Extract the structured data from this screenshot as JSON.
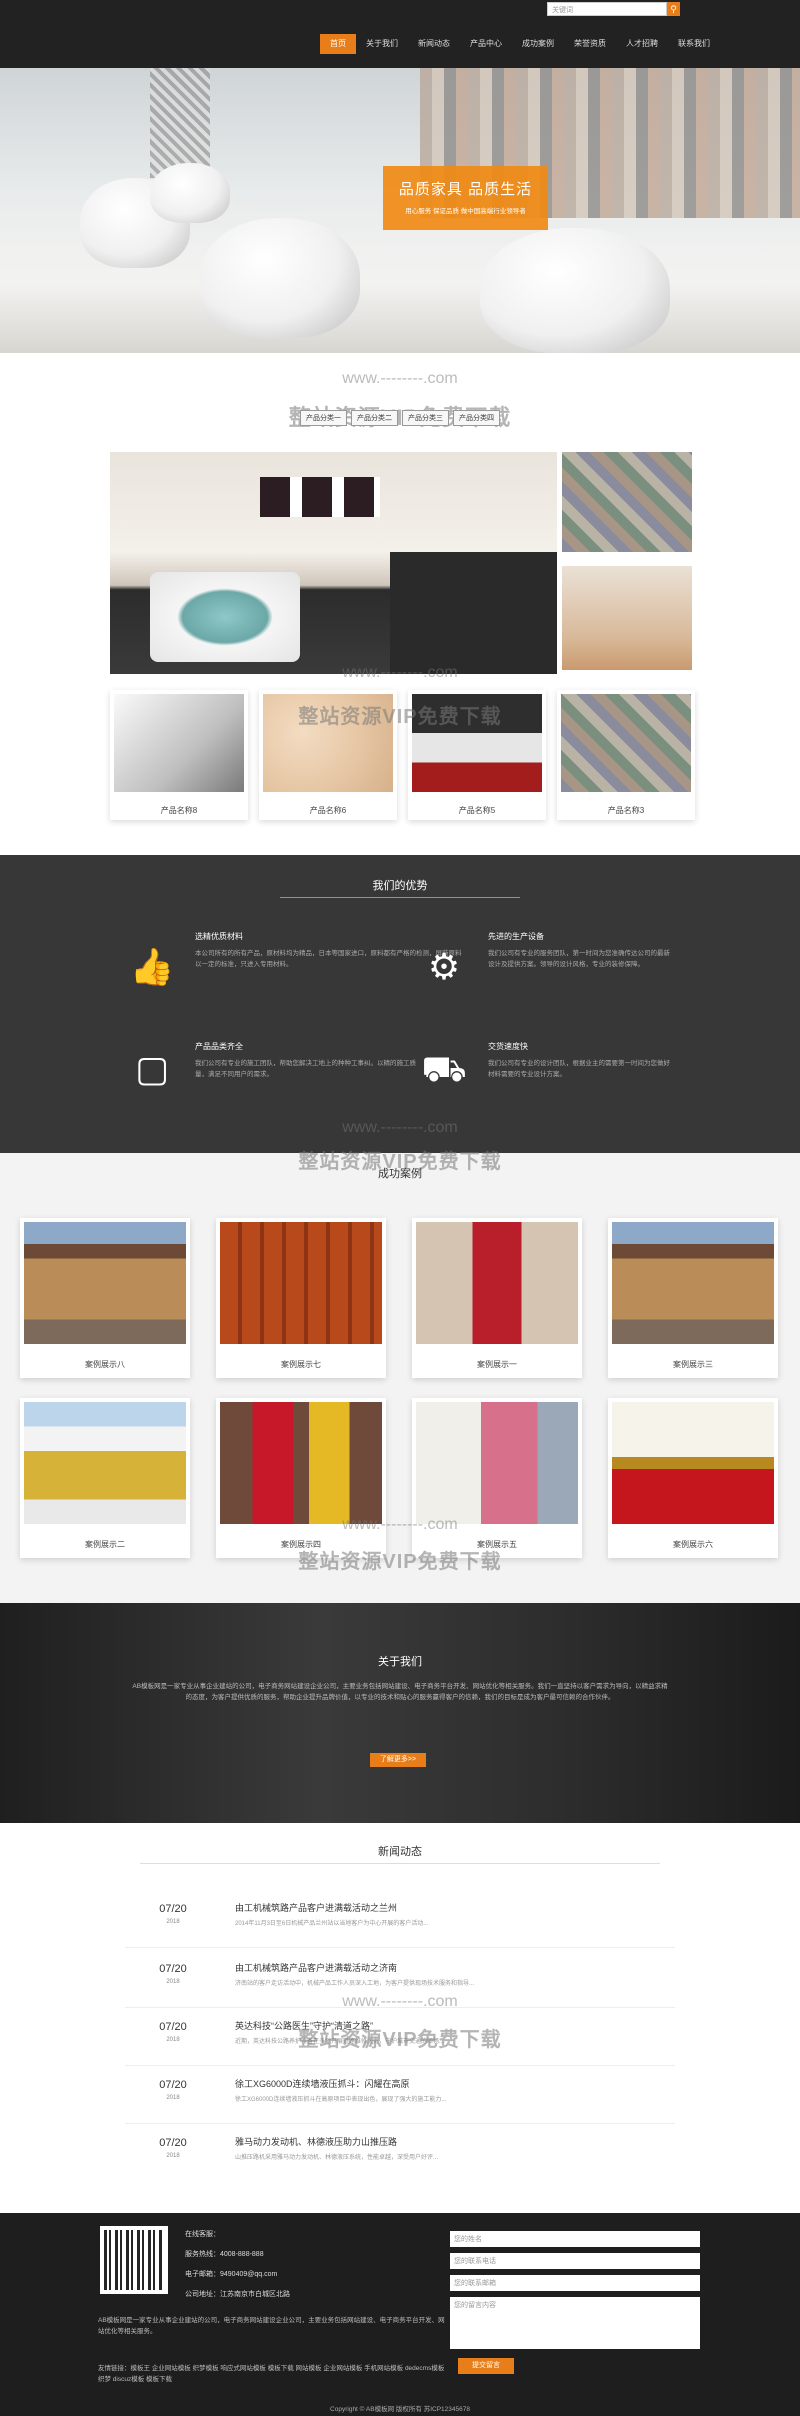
{
  "header": {
    "search_placeholder": "关键词",
    "search_icon": "search-icon",
    "nav": [
      {
        "label": "首页",
        "active": true
      },
      {
        "label": "关于我们",
        "active": false
      },
      {
        "label": "新闻动态",
        "active": false
      },
      {
        "label": "产品中心",
        "active": false
      },
      {
        "label": "成功案例",
        "active": false
      },
      {
        "label": "荣誉资质",
        "active": false
      },
      {
        "label": "人才招聘",
        "active": false
      },
      {
        "label": "联系我们",
        "active": false
      }
    ]
  },
  "hero": {
    "title": "品质家具 品质生活",
    "subtitle": "用心服务 保证品质 做中国高端行业领导者"
  },
  "watermark": {
    "url": "www.--------.com",
    "text": "整站资源VIP免费下载"
  },
  "products": {
    "tabs": [
      "产品分类一",
      "产品分类二",
      "产品分类三",
      "产品分类四"
    ],
    "items": [
      "产品名称8",
      "产品名称6",
      "产品名称5",
      "产品名称3"
    ]
  },
  "advantages": {
    "title": "我们的优势",
    "items": [
      {
        "title": "选精优质材料",
        "text": "本公司所有的所有产品，原材料均为精品，日本等国家进口，原料都有严格的检测，屏蔽原料以一定的标准，只进入专用材料。",
        "icon": "thumbs-up-icon"
      },
      {
        "title": "先进的生产设备",
        "text": "我们公司有专业的服务团队，第一时间为您准确传达公司的最新设计及提供方案。领导的设计风格，专业的装修保障。",
        "icon": "gear-icon"
      },
      {
        "title": "产品品类齐全",
        "text": "我们公司有专业的施工团队，帮助您解决工地上的种种工事纠。以精的施工质量，满足不同用户的需求。",
        "icon": "boxes-icon"
      },
      {
        "title": "交货速度快",
        "text": "我们公司有专业的设计团队，根据业主的需要第一时间为您做好材料需要的专业设计方案。",
        "icon": "truck-icon"
      }
    ]
  },
  "cases": {
    "title": "成功案例",
    "items": [
      "案例展示八",
      "案例展示七",
      "案例展示一",
      "案例展示三",
      "案例展示二",
      "案例展示四",
      "案例展示五",
      "案例展示六"
    ]
  },
  "about": {
    "title": "关于我们",
    "text": "AB模板网是一家专业从事企业建站的公司，电子商务网站建设企业公司，主要业务包括网站建设、电子商务平台开发、网站优化等相关服务。我们一直坚持以客户需求为导向，以精益求精的态度，为客户提供优质的服务，帮助企业提升品牌价值，以专业的技术和贴心的服务赢得客户的信赖，我们的目标是成为客户最可信赖的合作伙伴。",
    "button": "了解更多>>"
  },
  "news": {
    "title": "新闻动态",
    "items": [
      {
        "date": "07/20",
        "year": "2018",
        "title": "由工机械筑路产品客户进满载活动之兰州",
        "excerpt": "2014年11月3日至6日机械产品兰州站以当地客户为中心开展的客户活动..."
      },
      {
        "date": "07/20",
        "year": "2018",
        "title": "由工机械筑路产品客户进满载活动之济南",
        "excerpt": "济南站的客户走访活动中，机械产品工作人员深入工地，为客户提供现场技术服务和指导..."
      },
      {
        "date": "07/20",
        "year": "2018",
        "title": "英达科技“公路医生”守护“清道之路”",
        "excerpt": "近期，英达科技公路养护设备在多地开展道路维修服务，守护城市交通的顺畅..."
      },
      {
        "date": "07/20",
        "year": "2018",
        "title": "徐工XG6000D连续墙液压抓斗：闪耀在高原",
        "excerpt": "徐工XG6000D连续墙液压抓斗在高原项目中表现出色，展现了强大的施工能力..."
      },
      {
        "date": "07/20",
        "year": "2018",
        "title": "雅马动力发动机、林德液压助力山推压路",
        "excerpt": "山推压路机采用雅马动力发动机、林德液压系统，性能卓越，深受用户好评..."
      }
    ]
  },
  "footer": {
    "online": "在线客服：",
    "phone": "服务热线：4008-888-888",
    "email": "电子邮箱：9490409@qq.com",
    "address": "公司地址：江苏南京市白城区北路",
    "desc": "AB模板网是一家专业从事企业建站的公司，电子商务网站建设企业公司，主要业务包括网站建设、电子商务平台开发、网站优化等相关服务。",
    "links": "友情链接：模板王 企业网站模板 织梦模板 响应式网站模板 模板下载 网站模板 企业网站模板 手机网站模板 dedecms模板 织梦 discuz模板 模板下载",
    "form": [
      "您的姓名",
      "您的联系电话",
      "您的联系邮箱",
      "您的留言内容"
    ],
    "submit": "提交留言",
    "copyright": "Copyright © AB模板网 版权所有  苏ICP12345678"
  }
}
